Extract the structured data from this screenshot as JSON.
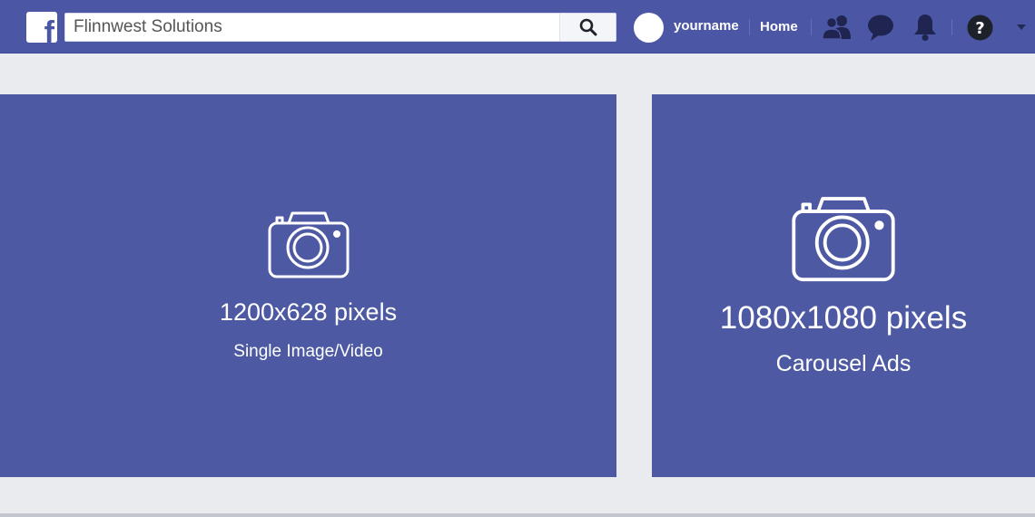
{
  "header": {
    "brand_icon": "facebook-logo-icon",
    "search": {
      "value": "Flinnwest Solutions",
      "icon": "search-icon"
    },
    "avatar_icon": "avatar",
    "username": "yourname",
    "home_label": "Home",
    "nav_icons": [
      "friends-icon",
      "messages-icon",
      "notifications-icon",
      "help-icon",
      "caret-down-icon"
    ],
    "help_glyph": "?"
  },
  "cards": [
    {
      "icon": "camera-icon",
      "dimensions": "1200x628 pixels",
      "label": "Single Image/Video"
    },
    {
      "icon": "camera-icon",
      "dimensions": "1080x1080 pixels",
      "label": "Carousel Ads"
    }
  ],
  "colors": {
    "header_bg": "#4b57a4",
    "card_bg": "#4d59a2",
    "page_bg": "#e9ebee",
    "text_light": "#ffffff"
  }
}
